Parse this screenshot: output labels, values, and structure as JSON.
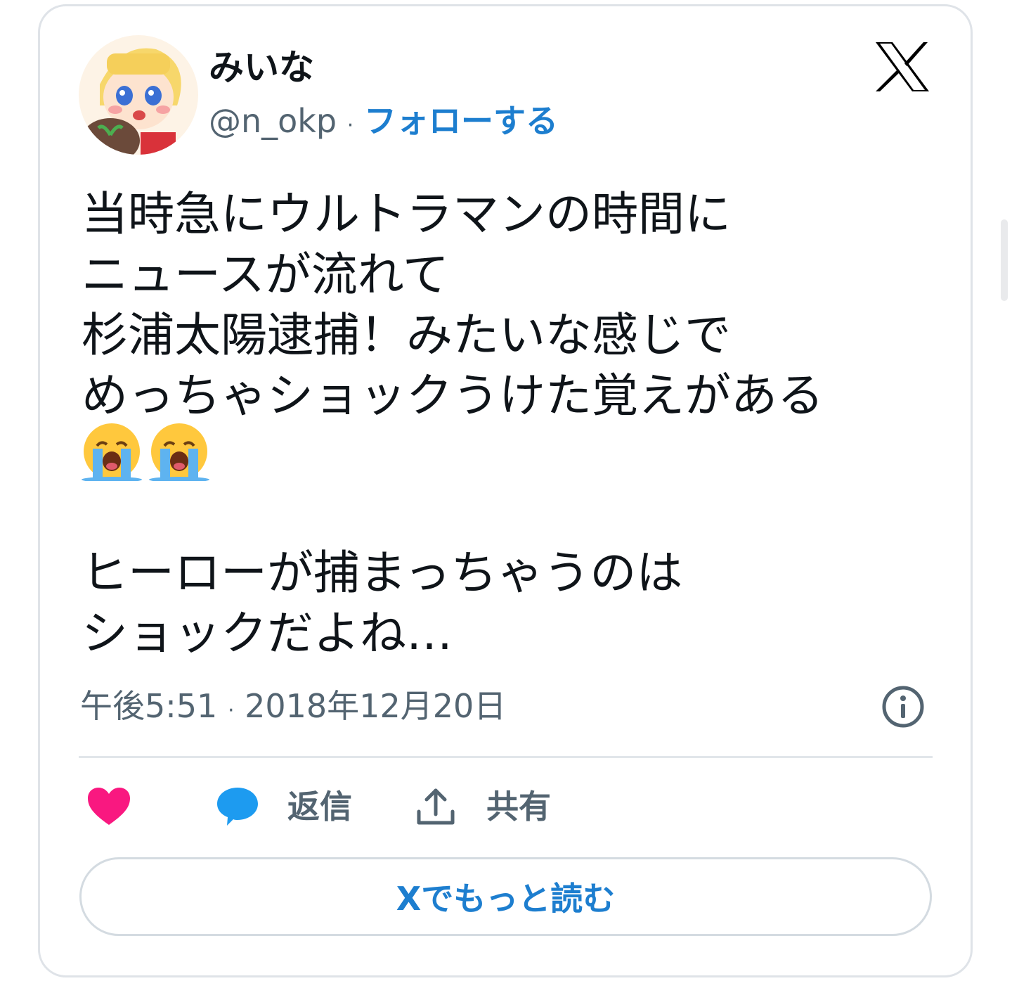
{
  "author": {
    "display_name": "みいな",
    "handle": "@n_okp",
    "separator": "·",
    "follow_label": "フォローする"
  },
  "tweet": {
    "text_part1": "当時急にウルトラマンの時間に\nニュースが流れて\n杉浦太陽逮捕！みたいな感じで\nめっちゃショックうけた覚えがある",
    "emojis": [
      "crying-face-emoji",
      "crying-face-emoji"
    ],
    "text_part2": "ヒーローが捕まっちゃうのは\nショックだよね…",
    "time": "午後5:51",
    "date_separator": "·",
    "date": "2018年12月20日"
  },
  "actions": {
    "like_icon": "heart-icon",
    "reply_icon": "speech-bubble-icon",
    "reply_label": "返信",
    "share_icon": "share-upload-icon",
    "share_label": "共有"
  },
  "read_more_label": "Xでもっと読む",
  "colors": {
    "link_blue": "#1d7ecf",
    "heart_pink": "#f91880",
    "reply_blue": "#1d9bf0",
    "secondary_text": "#536471",
    "primary_text": "#0f1419"
  }
}
